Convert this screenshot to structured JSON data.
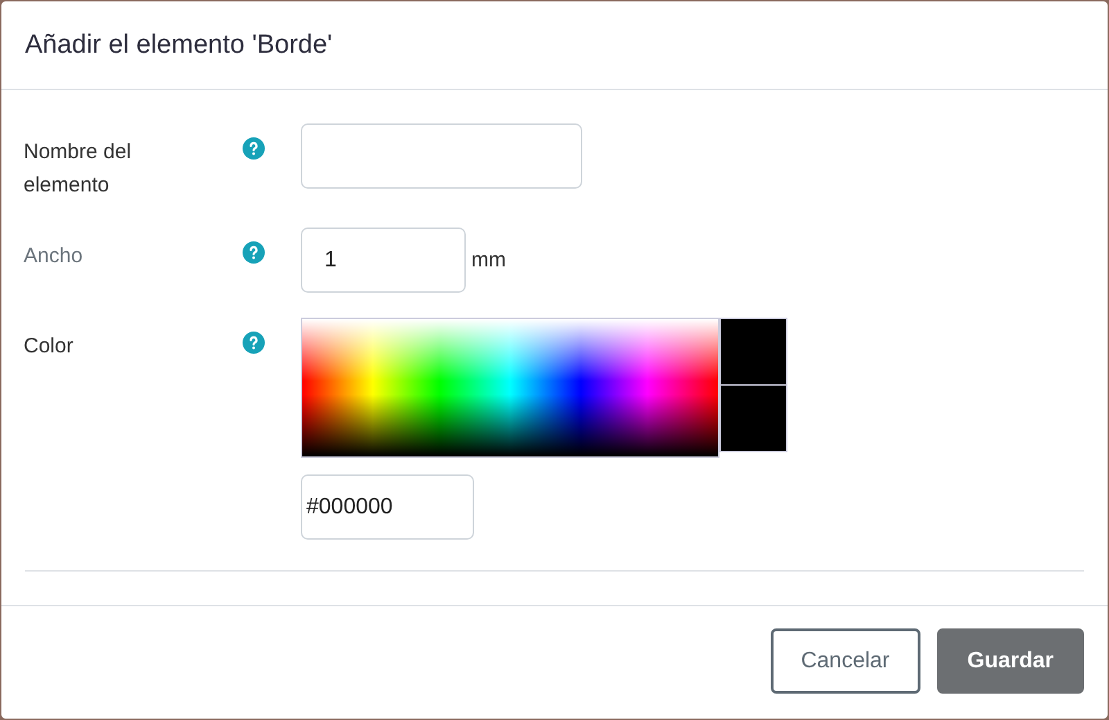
{
  "dialog": {
    "title": "Añadir el elemento 'Borde'"
  },
  "fields": [
    {
      "kind": "text",
      "label": "Nombre del elemento",
      "muted": false
    },
    {
      "kind": "number",
      "label": "Ancho",
      "value": "1",
      "unit": "mm",
      "muted": true
    },
    {
      "kind": "color",
      "label": "Color",
      "value": "#000000",
      "swatches": [
        {
          "color": "#000000"
        },
        {
          "color": "#000000"
        }
      ],
      "muted": false
    }
  ],
  "buttons": [
    {
      "kind": "secondary",
      "label": "Cancelar"
    },
    {
      "kind": "primary",
      "label": "Guardar"
    }
  ]
}
